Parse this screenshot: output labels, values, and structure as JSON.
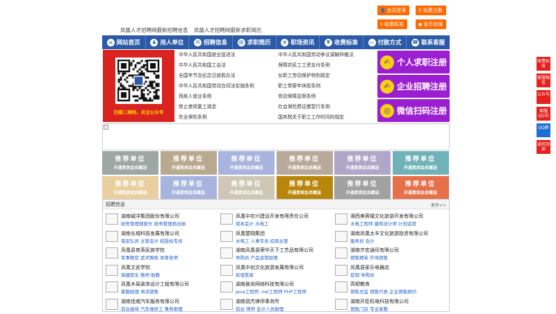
{
  "header": {
    "slogans": [
      "凤凰人才招聘网最新招聘信息",
      "凤凰人才招聘网最新求职简历"
    ],
    "buttons": [
      {
        "label": "会员登录",
        "icon": "user-icon"
      },
      {
        "label": "免费注册",
        "icon": "key-icon"
      },
      {
        "label": "收费标准",
        "icon": "yen-icon"
      },
      {
        "label": "金币充值",
        "icon": "coin-icon"
      }
    ]
  },
  "nav": {
    "items": [
      {
        "label": "网站首页",
        "icon": "home-icon",
        "glyph": "⌂"
      },
      {
        "label": "用人单位",
        "icon": "user-icon",
        "glyph": "♟"
      },
      {
        "label": "招聘信息",
        "icon": "chat-icon",
        "glyph": "✉"
      },
      {
        "label": "求职简历",
        "icon": "resume-icon",
        "glyph": "▤"
      },
      {
        "label": "职场资讯",
        "icon": "news-icon",
        "glyph": "≡"
      },
      {
        "label": "收费标准",
        "icon": "yen-icon",
        "glyph": "¥"
      },
      {
        "label": "付款方式",
        "icon": "card-icon",
        "glyph": "▭"
      },
      {
        "label": "联系客服",
        "icon": "phone-icon",
        "glyph": "☎"
      }
    ]
  },
  "qr": {
    "caption": "扫描二维码，关注公众号"
  },
  "laws": {
    "left": [
      "中华人民共和国就业促进法",
      "中华人民共和国工会法",
      "全国年节及纪念日放假办法",
      "中华人民共和国劳动合同法实施条例",
      "残疾人就业条例",
      "禁止使用童工规定",
      "失业保险条例"
    ],
    "right": [
      "中华人民共和国劳动争议调解仲裁法",
      "保障农民工工资支付条例",
      "女职工劳动保护特别规定",
      "职工带薪年休假条例",
      "劳动保障监察条例",
      "社会保险费征缴暂行条例",
      "国务院关于职工工作时间的规定"
    ]
  },
  "register": [
    {
      "label": "个人求职注册",
      "color": "#9b1fd1",
      "glyph": "✍"
    },
    {
      "label": "企业招聘注册",
      "color": "#9b1fd1",
      "glyph": "✍"
    },
    {
      "label": "微信扫码注册",
      "color": "#9b1fd1",
      "glyph": "◎"
    }
  ],
  "recommend": {
    "title": "推荐单位",
    "subtitle": "开通贵宾会员赠送",
    "colors": [
      "#9da7a3",
      "#b8a98f",
      "#a7b4de",
      "#b9a99a",
      "#b0a7c8",
      "#6fb3b8",
      "#e9cfa0",
      "#a7b4de",
      "#cfc7b4",
      "#b8860b",
      "#a1a1a1",
      "#e5704a"
    ]
  },
  "jobs": {
    "header": "招聘信息",
    "more": "更多>>",
    "list": [
      {
        "company": "湖南碱洋集团股份有限公司",
        "positions": "财务管理部部长 财务管理部出纳"
      },
      {
        "company": "凤凰中农兴建设开发有限责任公司",
        "positions": "成本会计 水电工"
      },
      {
        "company": "湘西美蓉镇文化旅游开发有限公司",
        "positions": "水电工程师 建筑设计师 计划运营"
      },
      {
        "company": "湖南长城科技发展有限公司",
        "positions": "保安队员 主管会计 招投标专员"
      },
      {
        "company": "凤凰楚翔集团",
        "positions": "水电工 人事专员 招商主管"
      },
      {
        "company": "湖南凤凰太丰文化旅游投资有限公司",
        "positions": "服务员 会计"
      },
      {
        "company": "凤凰县育英民族学校",
        "positions": "军事教官 武术教练 体育老师"
      },
      {
        "company": "湖南凤凰县荣华天下工艺品有限公司",
        "positions": "导购员 产品运营经理"
      },
      {
        "company": "湖南齐宏通讯有限公司",
        "positions": "销售精英 外场销售"
      },
      {
        "company": "凤凰文武学校",
        "positions": "保健医生 教师·助教"
      },
      {
        "company": "凤凰中创文化旅游发展有限公司",
        "positions": "民宿管家"
      },
      {
        "company": "凤凰县家乐电器店",
        "positions": "促销·导购员"
      },
      {
        "company": "凤凰木易装饰设计工程有限公司",
        "positions": "客服经理 电话销售"
      },
      {
        "company": "湖南居尚网络科技有限公司",
        "positions": "Java工程师 .net工程师 PHP工程师"
      },
      {
        "company": "高顿教育",
        "positions": "销售总监 销售代表 企业销售顾问"
      },
      {
        "company": "湖南佳威汽车服务有限公司",
        "positions": "前台接待 汽车维修工 事务助理"
      },
      {
        "company": "湖南锐杰律师事务所",
        "positions": "前台 律师 会计人员助理"
      },
      {
        "company": "湖南开臣机电科技有限公司",
        "positions": "销售门店 专业家教"
      }
    ]
  },
  "sidebar": [
    {
      "label": "收费标准"
    },
    {
      "label": "客服微信"
    },
    {
      "label": "公众号"
    },
    {
      "label": "客服QQ号"
    },
    {
      "label": "QQ群"
    },
    {
      "label": "返回顶部"
    }
  ]
}
